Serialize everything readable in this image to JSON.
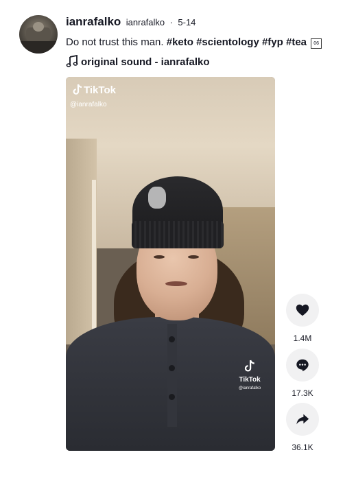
{
  "post": {
    "author_name": "ianrafalko",
    "author_handle": "ianrafalko",
    "separator": "·",
    "date": "5-14",
    "caption_text": "Do not trust this man.",
    "hashtags": [
      "#keto",
      "#scientology",
      "#fyp",
      "#tea"
    ],
    "emoji_placeholder": "06",
    "sound_label": "original sound - ianrafalko"
  },
  "video": {
    "watermark_brand": "TikTok",
    "watermark_handle": "@ianrafalko",
    "watermark_bottom_brand": "TikTok",
    "watermark_bottom_handle": "@ianrafalko"
  },
  "actions": {
    "likes": {
      "icon": "heart-icon",
      "count": "1.4M"
    },
    "comments": {
      "icon": "comment-icon",
      "count": "17.3K"
    },
    "shares": {
      "icon": "share-icon",
      "count": "36.1K"
    }
  },
  "colors": {
    "text": "#161823",
    "action_bg": "#f1f1f2"
  }
}
